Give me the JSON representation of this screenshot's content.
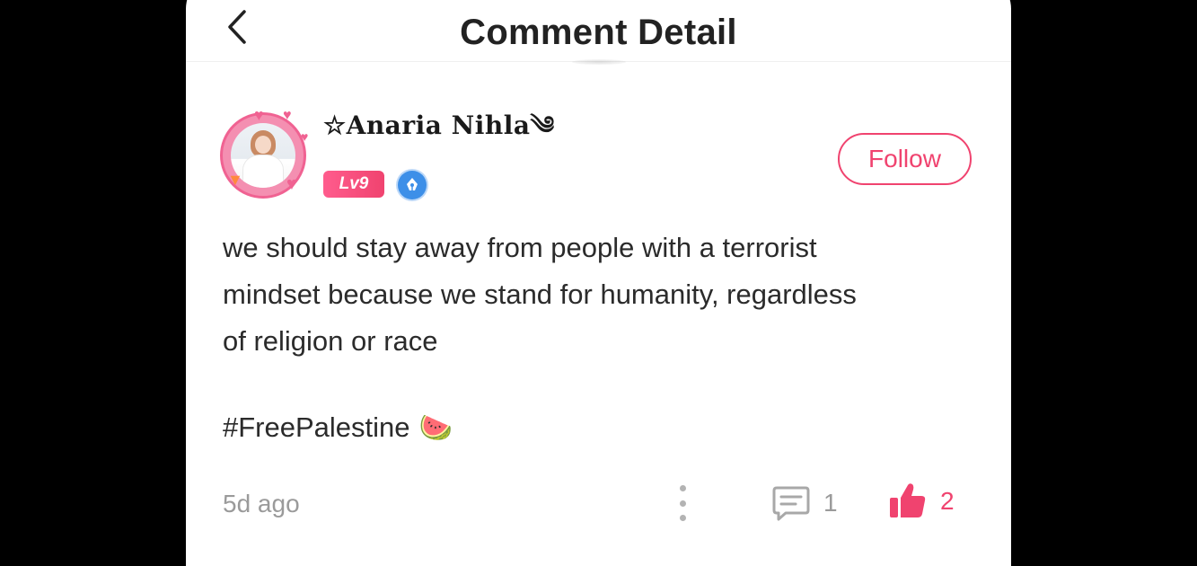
{
  "header": {
    "title": "Comment Detail"
  },
  "author": {
    "name": "☆Anaria Nihla༄",
    "level": "Lv9",
    "follow_label": "Follow"
  },
  "comment": {
    "text": "we should stay away from people with a terrorist\nmindset because we stand for humanity, regardless\nof religion or race",
    "hashtag": "#FreePalestine",
    "emoji": "🍉",
    "timestamp": "5d ago"
  },
  "actions": {
    "reply_count": "1",
    "like_count": "2"
  },
  "colors": {
    "accent": "#f0436f",
    "muted": "#9a9a9a",
    "text": "#2b2b2b",
    "badge_blue": "#3d8fe8"
  },
  "icons": {
    "back": "chevron-left-icon",
    "more": "more-vertical-icon",
    "reply": "comment-icon",
    "like": "thumbs-up-icon",
    "role": "pen-nib-icon"
  }
}
